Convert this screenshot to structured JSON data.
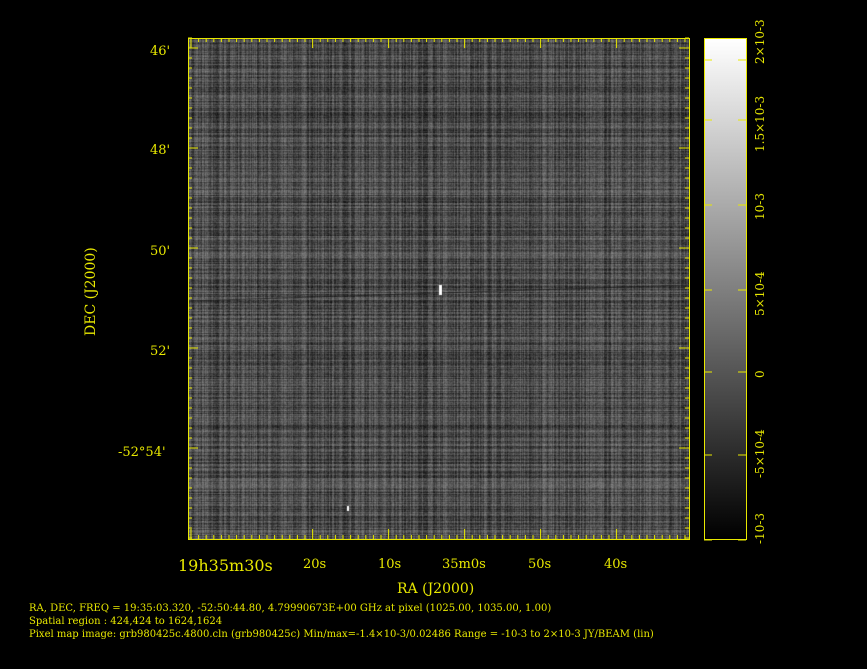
{
  "x_axis": {
    "title": "RA (J2000)",
    "ticks": [
      {
        "label": "19h35m30s"
      },
      {
        "label": "20s"
      },
      {
        "label": "10s"
      },
      {
        "label": "35m0s"
      },
      {
        "label": "50s"
      },
      {
        "label": "40s"
      }
    ]
  },
  "y_axis": {
    "title": "DEC (J2000)",
    "ticks": [
      {
        "label": "46'"
      },
      {
        "label": "48'"
      },
      {
        "label": "50'"
      },
      {
        "label": "52'"
      },
      {
        "label": "-52°54'"
      }
    ]
  },
  "colorbar": {
    "ticks": [
      {
        "label": "2×10-3"
      },
      {
        "label": "1.5×10-3"
      },
      {
        "label": "10-3"
      },
      {
        "label": "5×10-4"
      },
      {
        "label": "0"
      },
      {
        "label": "-5×10-4"
      },
      {
        "label": "-10-3"
      }
    ]
  },
  "info": {
    "line1": "RA, DEC, FREQ = 19:35:03.320, -52:50:44.80, 4.79990673E+00 GHz at pixel (1025.00, 1035.00, 1.00)",
    "line2": "Spatial region : 424,424 to 1624,1624",
    "line3": "Pixel map image: grb980425c.4800.cln (grb980425c)  Min/max=-1.4×10-3/0.02486  Range = -10-3 to 2×10-3 JY/BEAM (lin)"
  },
  "colors": {
    "axis": "#e8e800",
    "background": "#000000"
  }
}
